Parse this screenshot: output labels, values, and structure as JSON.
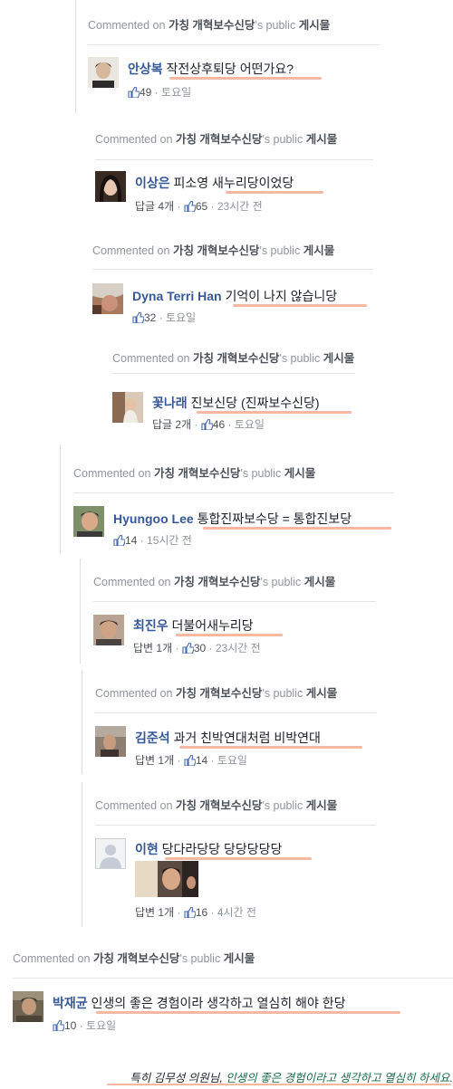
{
  "header": {
    "prefix": "Commented on",
    "page": "가칭 개혁보수신당",
    "suffix": "'s public",
    "group": "게시물"
  },
  "comments": [
    {
      "author": "안상복",
      "text": "작전상후퇴당 어떤가요?",
      "replies": "",
      "likes": "49",
      "time": "토요일"
    },
    {
      "author": "이상은",
      "text": "피소영 새누리당이었당",
      "replies": "답글 4개",
      "likes": "65",
      "time": "23시간 전"
    },
    {
      "author": "Dyna Terri Han",
      "text": "기억이 나지 않습니당",
      "replies": "",
      "likes": "32",
      "time": "토요일"
    },
    {
      "author": "꽃나래",
      "text": "진보신당 (진짜보수신당)",
      "replies": "답글 2개",
      "likes": "46",
      "time": "토요일"
    },
    {
      "author": "Hyungoo Lee",
      "text": "통합진짜보수당 = 통합진보당",
      "replies": "",
      "likes": "14",
      "time": "15시간 전"
    },
    {
      "author": "최진우",
      "text": "더불어새누리당",
      "replies": "답변 1개",
      "likes": "30",
      "time": "23시간 전"
    },
    {
      "author": "김준석",
      "text": "과거 친박연대처럼 비박연대",
      "replies": "답변 1개",
      "likes": "14",
      "time": "토요일"
    },
    {
      "author": "이현",
      "text": "당다라당당 당당당당당",
      "replies": "답변 1개",
      "likes": "16",
      "time": "4시간 전"
    },
    {
      "author": "박재균",
      "text": "인생의 좋은 경험이라 생각하고 열심히 해야 한당",
      "replies": "",
      "likes": "10",
      "time": "토요일"
    }
  ],
  "footer": {
    "part1": "특히 김무성 의원님, ",
    "part2": "인생의 좋은 경험이라고 생각하고 열심히 하세요."
  }
}
